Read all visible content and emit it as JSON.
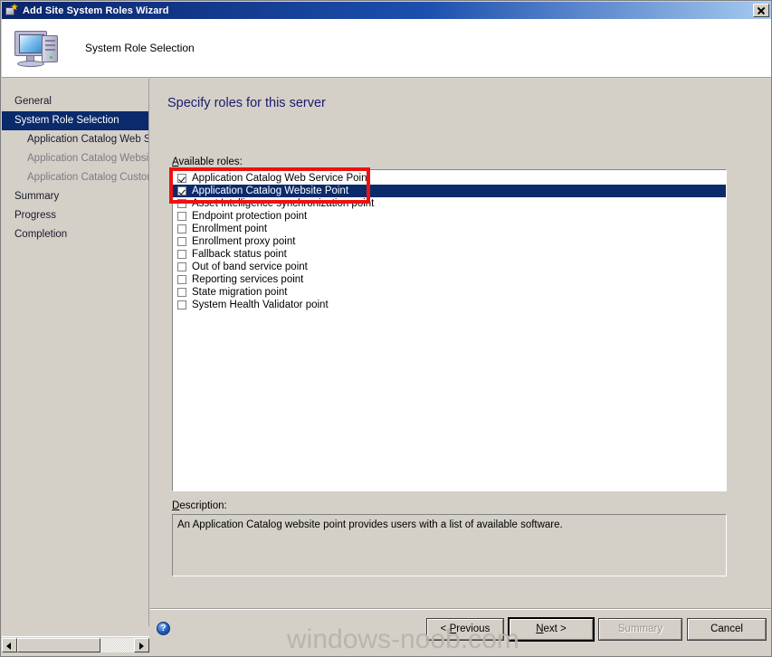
{
  "window": {
    "title": "Add Site System Roles Wizard",
    "app_icon": "wizard-icon",
    "close_label": "x"
  },
  "header": {
    "icon": "computer-icon",
    "title": "System Role Selection"
  },
  "sidebar": {
    "items": [
      {
        "label": "General",
        "level": "top",
        "state": "normal"
      },
      {
        "label": "System Role Selection",
        "level": "top",
        "state": "selected"
      },
      {
        "label": "Application Catalog Web Service Point",
        "level": "child",
        "state": "strong"
      },
      {
        "label": "Application Catalog Website Point",
        "level": "child",
        "state": "dim"
      },
      {
        "label": "Application Catalog Customizations",
        "level": "child",
        "state": "dim"
      },
      {
        "label": "Summary",
        "level": "top",
        "state": "normal"
      },
      {
        "label": "Progress",
        "level": "top",
        "state": "normal"
      },
      {
        "label": "Completion",
        "level": "top",
        "state": "normal"
      }
    ]
  },
  "main": {
    "page_title": "Specify roles for this server",
    "available_roles_label_prefix": "A",
    "available_roles_label_rest": "vailable roles:",
    "roles": [
      {
        "label": "Application Catalog Web Service Point",
        "checked": true,
        "selected": false
      },
      {
        "label": "Application Catalog Website Point",
        "checked": true,
        "selected": true
      },
      {
        "label": "Asset Intelligence synchronization point",
        "checked": false,
        "selected": false
      },
      {
        "label": "Endpoint protection point",
        "checked": false,
        "selected": false
      },
      {
        "label": "Enrollment point",
        "checked": false,
        "selected": false
      },
      {
        "label": "Enrollment proxy point",
        "checked": false,
        "selected": false
      },
      {
        "label": "Fallback status point",
        "checked": false,
        "selected": false
      },
      {
        "label": "Out of band service point",
        "checked": false,
        "selected": false
      },
      {
        "label": "Reporting services point",
        "checked": false,
        "selected": false
      },
      {
        "label": "State migration point",
        "checked": false,
        "selected": false
      },
      {
        "label": "System Health Validator point",
        "checked": false,
        "selected": false
      }
    ],
    "description_label_prefix": "D",
    "description_label_rest": "escription:",
    "description_text": "An Application Catalog website point provides users with a list of available software."
  },
  "footer": {
    "help_icon": "help-icon",
    "help_glyph": "?",
    "buttons": {
      "previous_prefix": "< ",
      "previous_accel": "P",
      "previous_rest": "revious",
      "next_accel": "N",
      "next_rest": "ext >",
      "summary": "Summary",
      "cancel": "Cancel"
    }
  },
  "scrollbar": {
    "left_arrow": "left-arrow-icon",
    "right_arrow": "right-arrow-icon"
  },
  "annotation": {
    "highlight_color": "#ee1111"
  },
  "watermark": {
    "text": "windows-noob.com"
  }
}
